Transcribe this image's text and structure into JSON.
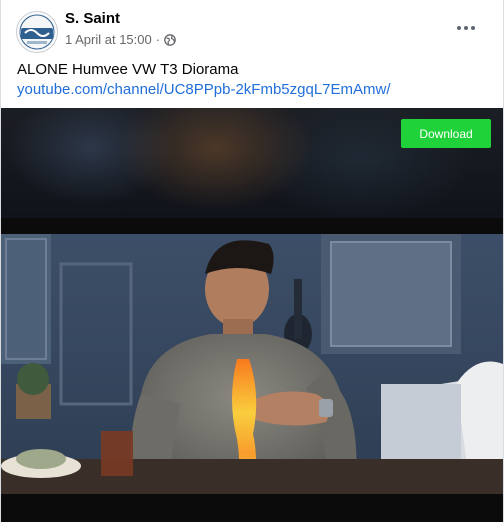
{
  "post": {
    "author": "S. Saint",
    "timestamp": "1 April at 15:00",
    "separator": "·",
    "privacy_icon": "globe-icon",
    "menu_icon": "more-options-icon",
    "title": "ALONE Humvee VW T3 Diorama",
    "link": "youtube.com/channel/UC8PPpb-2kFmb5zgqL7EmAmw/"
  },
  "avatar": {
    "logo_text": "Saint"
  },
  "video": {
    "download_label": "Download"
  },
  "colors": {
    "link": "#216fdb",
    "download": "#1fd23a",
    "meta": "#65676b"
  }
}
